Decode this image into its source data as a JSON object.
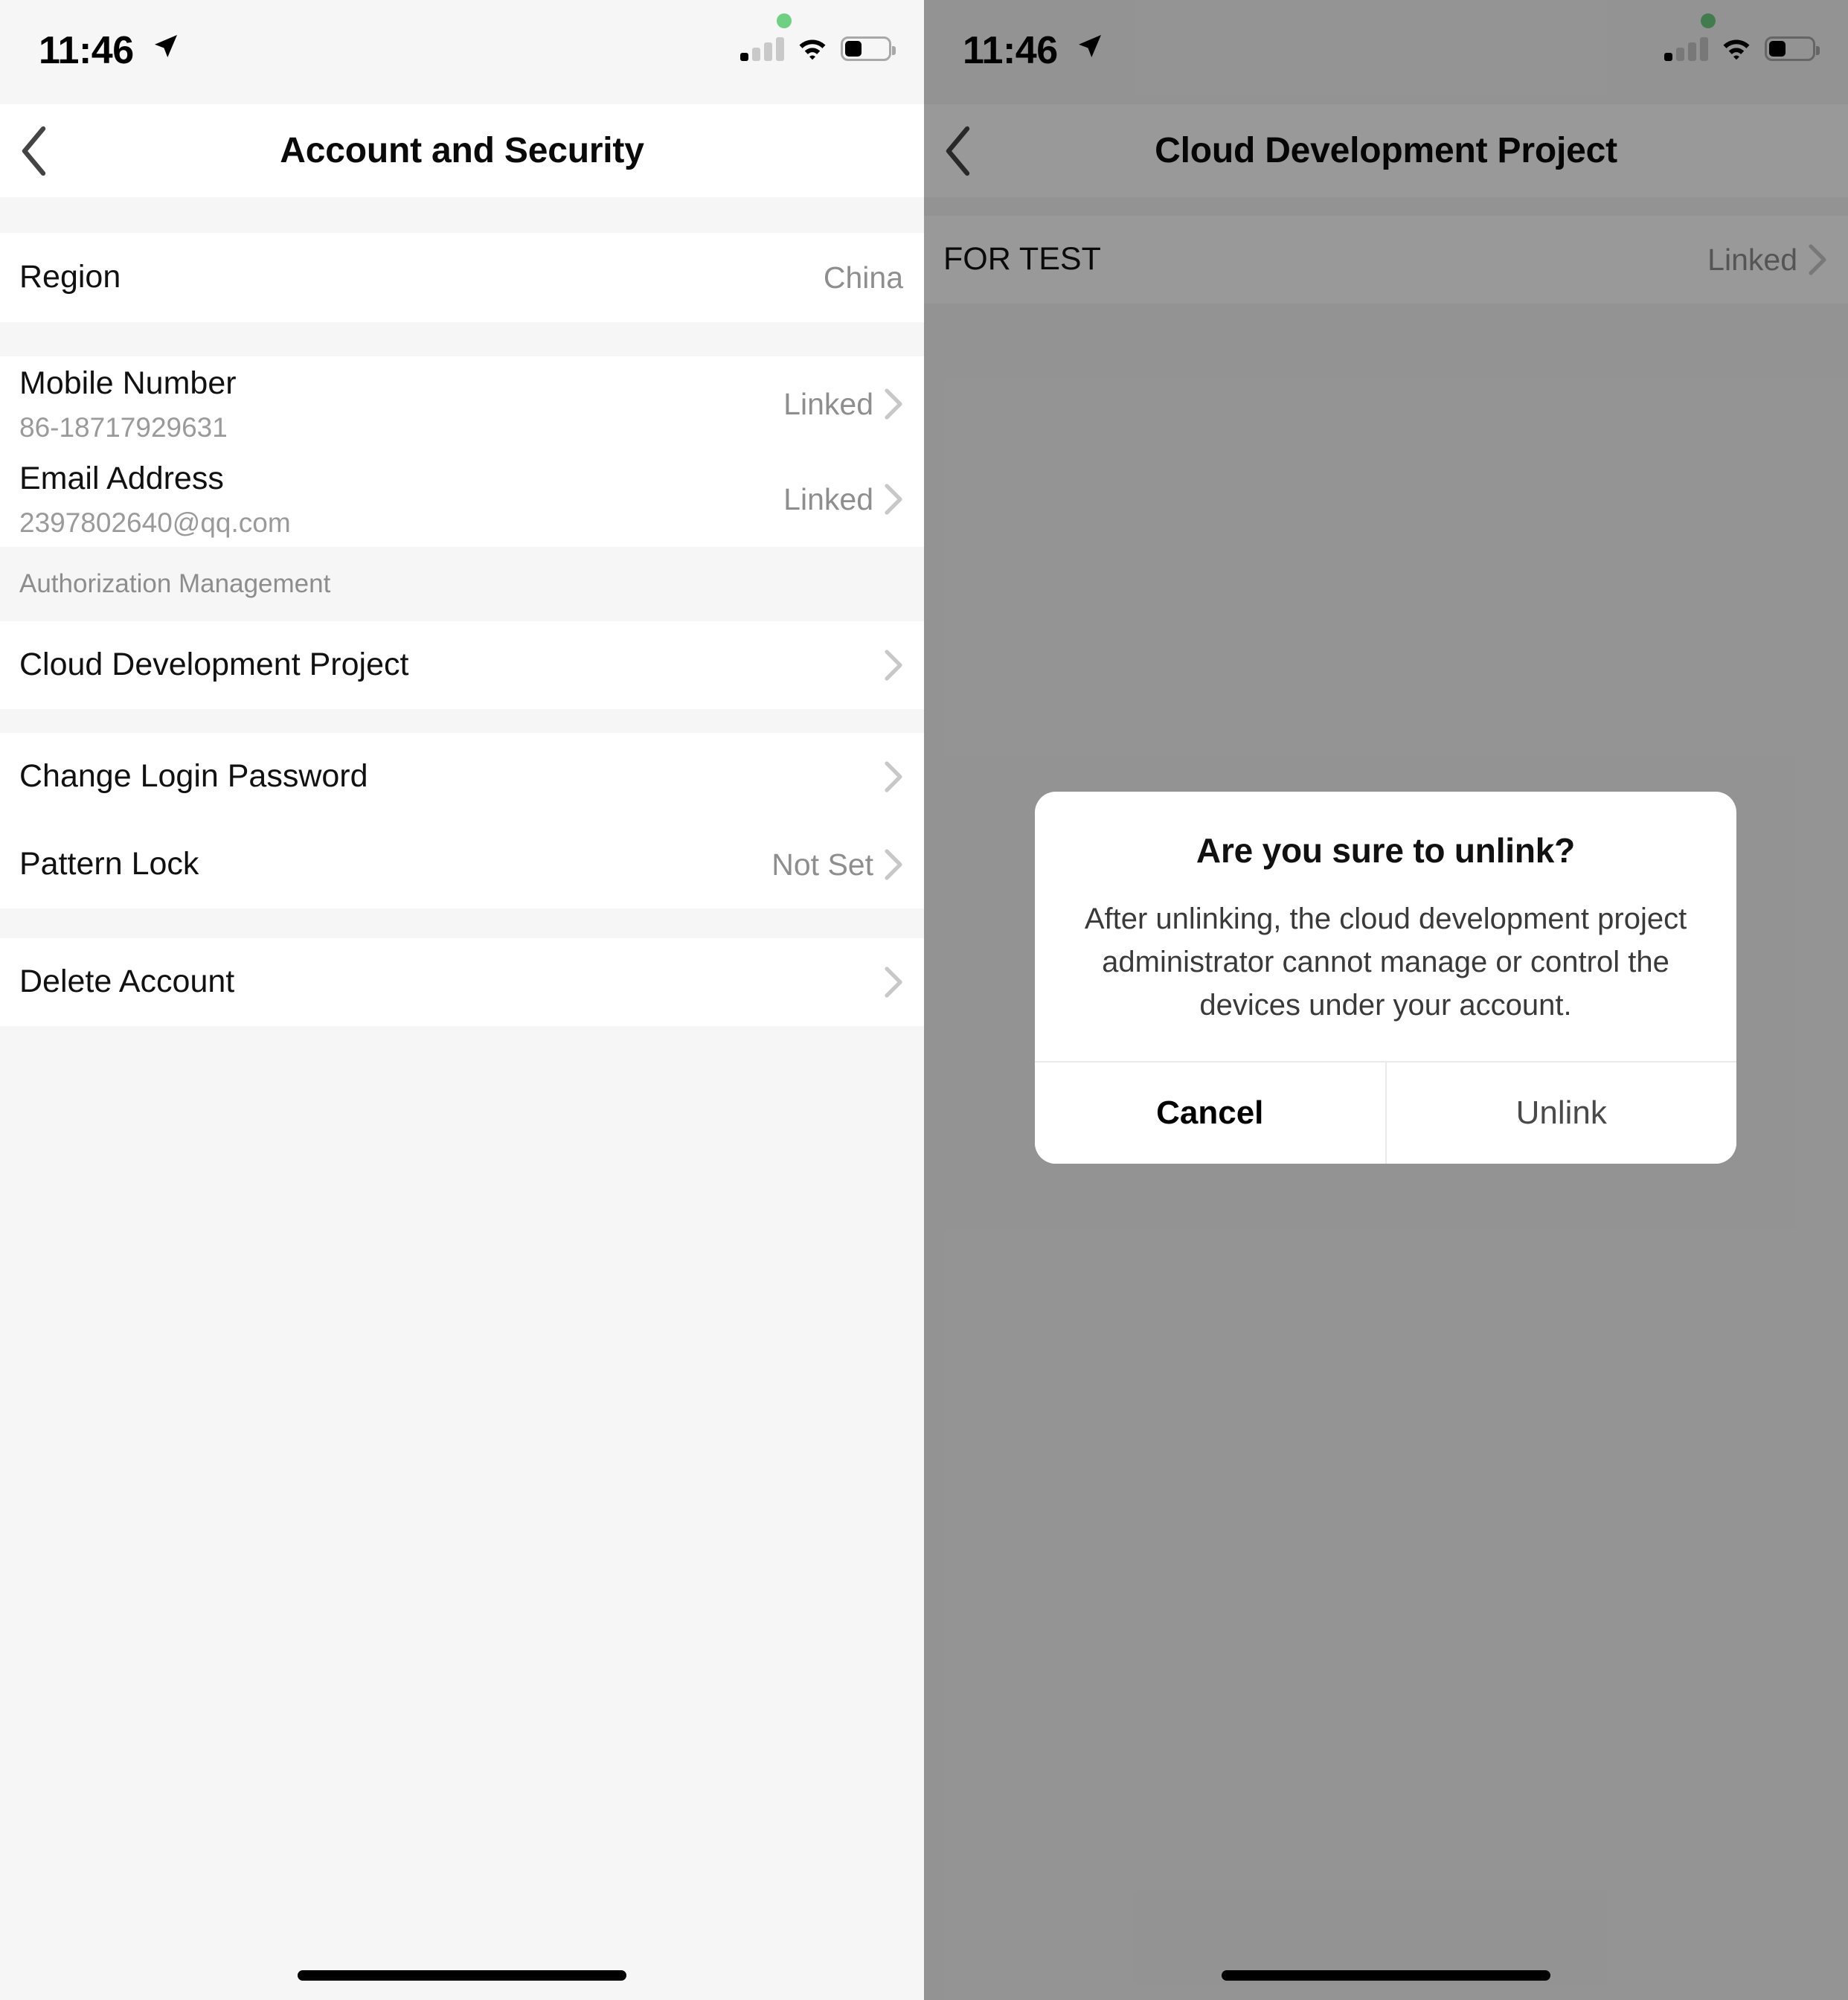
{
  "status_bar": {
    "time": "11:46",
    "location_icon": "location-arrow-icon",
    "signal_icon": "cellular-signal-icon",
    "wifi_icon": "wifi-icon",
    "battery_icon": "battery-icon",
    "battery_level_percent": 40,
    "recording_dot_color": "#6fcf82"
  },
  "left_screen": {
    "nav": {
      "back_icon": "chevron-left-icon",
      "title": "Account and Security"
    },
    "groups": [
      {
        "rows": [
          {
            "title": "Region",
            "sub": "",
            "value": "China",
            "chevron": false
          }
        ]
      },
      {
        "rows": [
          {
            "title": "Mobile Number",
            "sub": "86-18717929631",
            "value": "Linked",
            "chevron": true
          },
          {
            "title": "Email Address",
            "sub": "2397802640@qq.com",
            "value": "Linked",
            "chevron": true
          }
        ]
      }
    ],
    "section_header": "Authorization Management",
    "auth_rows": [
      {
        "title": "Cloud Development Project",
        "sub": "",
        "value": "",
        "chevron": true
      }
    ],
    "security_rows": [
      {
        "title": "Change Login Password",
        "sub": "",
        "value": "",
        "chevron": true
      },
      {
        "title": "Pattern Lock",
        "sub": "",
        "value": "Not Set",
        "chevron": true
      }
    ],
    "danger_rows": [
      {
        "title": "Delete Account",
        "sub": "",
        "value": "",
        "chevron": true
      }
    ]
  },
  "right_screen": {
    "nav": {
      "back_icon": "chevron-left-icon",
      "title": "Cloud Development Project"
    },
    "rows": [
      {
        "title": "FOR TEST",
        "sub": "",
        "value": "Linked",
        "chevron": true
      }
    ],
    "dialog": {
      "title": "Are you sure to unlink?",
      "message": "After unlinking, the cloud development project administrator cannot manage or control the devices under your account.",
      "cancel_label": "Cancel",
      "confirm_label": "Unlink"
    }
  },
  "colors": {
    "page_background": "#f6f6f6",
    "row_background": "#ffffff",
    "primary_text": "#111111",
    "secondary_text": "#8e8e8e",
    "chevron": "#c8c8c8",
    "dim_overlay": "rgba(0,0,0,0.40)"
  }
}
